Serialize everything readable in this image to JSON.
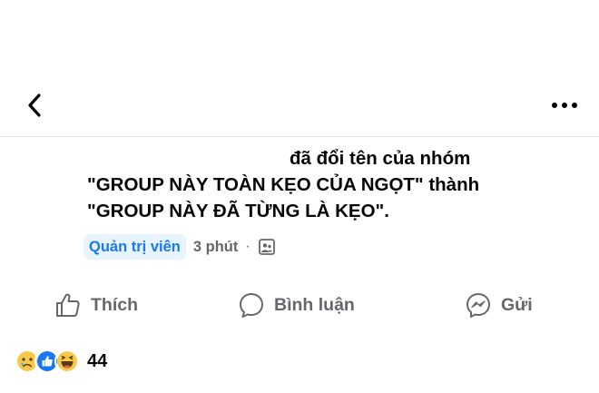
{
  "header": {
    "back_icon": "chevron-left-icon",
    "more_icon": "more-horizontal-icon"
  },
  "post": {
    "line1": "đã đổi tên của nhóm",
    "line2": "\"GROUP NÀY TOÀN KẸO CỦA NGỌT\" thành",
    "line3": "\"GROUP NÀY ĐÃ TỪNG LÀ KẸO\"."
  },
  "meta": {
    "role": "Quản trị viên",
    "time": "3 phút",
    "separator": "·",
    "audience_icon": "group-audience-icon"
  },
  "actions": {
    "like": "Thích",
    "comment": "Bình luận",
    "share": "Gửi"
  },
  "reactions": {
    "icons": [
      "sad-reaction-icon",
      "like-reaction-icon",
      "haha-reaction-icon"
    ],
    "count": "44"
  },
  "colors": {
    "accent": "#1877f2",
    "secondary_text": "#65676b",
    "badge_bg": "#e7f3ff"
  }
}
